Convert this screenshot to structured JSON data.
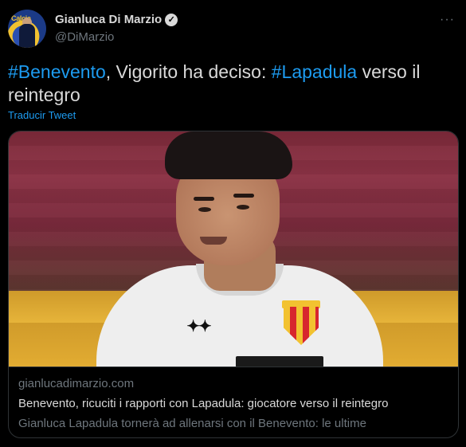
{
  "author": {
    "name": "Gianluca Di Marzio",
    "handle": "@DiMarzio",
    "avatar_text": "Calcia",
    "verified_icon": "verified-check-icon"
  },
  "more_icon": "more-options-icon",
  "tweet": {
    "hashtag1": "#Benevento",
    "text1": ", Vigorito ha deciso: ",
    "hashtag2": "#Lapadula",
    "text2": " verso il reintegro",
    "translate_label": "Traducir Tweet"
  },
  "card": {
    "domain": "gianlucadimarzio.com",
    "title": "Benevento, ricuciti i rapporti con Lapadula: giocatore verso il reintegro",
    "description": "Gianluca Lapadula tornerà ad allenarsi con il Benevento: le ultime"
  },
  "colors": {
    "background": "#000000",
    "link": "#1d9bf0",
    "text": "#d9d9d9",
    "muted": "#6e767d",
    "border": "#2f3336"
  }
}
